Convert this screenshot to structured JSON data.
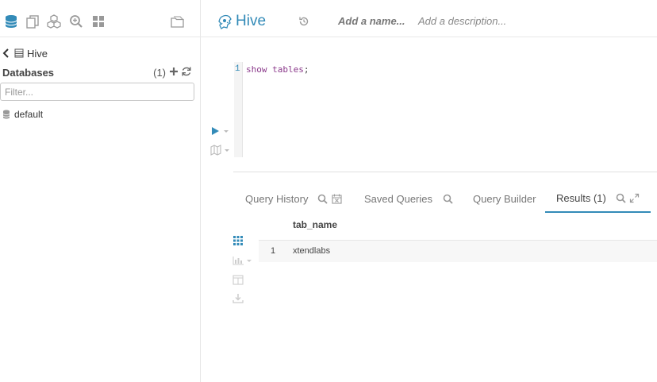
{
  "app": {
    "accent": "#338bb8"
  },
  "assist": {
    "icons": [
      "database-icon",
      "documents-icon",
      "cubes-icon",
      "search-plus-icon",
      "grid-icon",
      "folder-open-icon"
    ]
  },
  "left": {
    "breadcrumb": "Hive",
    "databases_label": "Databases",
    "databases_count": "(1)",
    "filter_placeholder": "Filter...",
    "databases": [
      {
        "name": "default"
      }
    ]
  },
  "editor": {
    "title": "Hive",
    "name_placeholder": "Add a name...",
    "description_placeholder": "Add a description...",
    "line_number": "1",
    "code_keyword1": "show",
    "code_keyword2": "tables",
    "code_end": ";"
  },
  "tabs": [
    {
      "label": "Query History"
    },
    {
      "label": "Saved Queries"
    },
    {
      "label": "Query Builder"
    },
    {
      "label": "Results (1)"
    }
  ],
  "results": {
    "columns": [
      "tab_name"
    ],
    "rows": [
      {
        "row_number": "1",
        "tab_name": "xtendlabs"
      }
    ]
  }
}
